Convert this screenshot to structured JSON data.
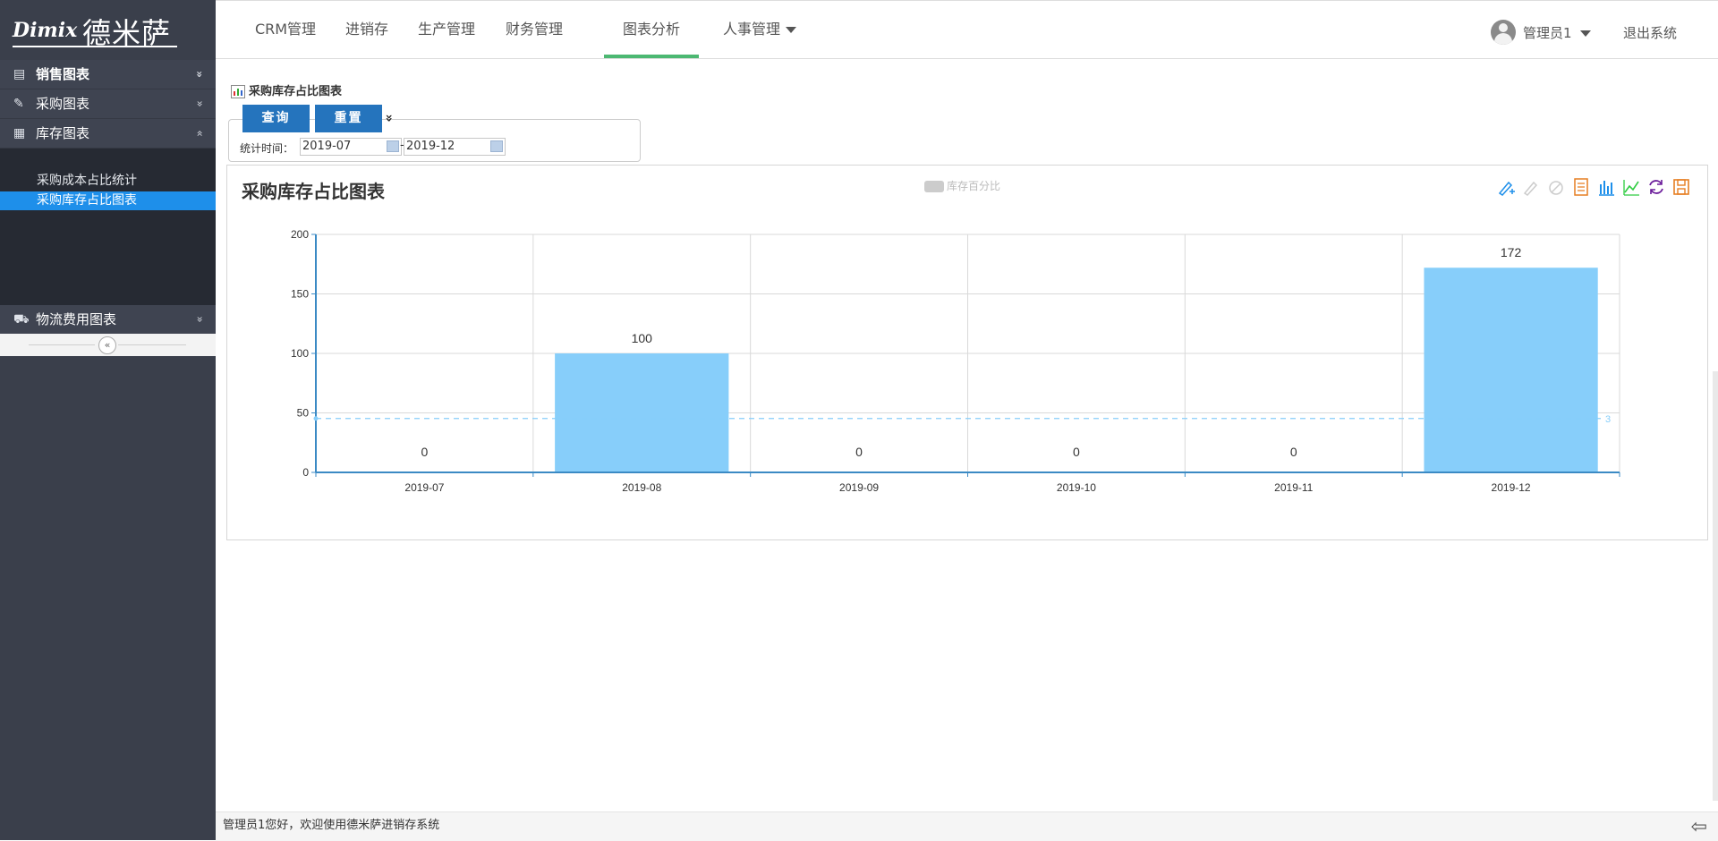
{
  "logo": {
    "latin": "Dimix",
    "cn": "德米萨"
  },
  "sidebar": {
    "groups": [
      {
        "label": "销售图表",
        "icon": "chart-card-icon",
        "chevron": "»"
      },
      {
        "label": "采购图表",
        "icon": "edit-icon",
        "chevron": "»"
      },
      {
        "label": "库存图表",
        "icon": "table-icon",
        "chevron": "«"
      }
    ],
    "sub_items": [
      {
        "label": "采购成本占比统计"
      },
      {
        "label": "采购库存占比图表"
      }
    ],
    "bottom_group": {
      "label": "物流费用图表",
      "icon": "truck-icon",
      "chevron": "»"
    },
    "collapse_glyph": "«"
  },
  "topnav": {
    "items": [
      "CRM管理",
      "进销存",
      "生产管理",
      "财务管理",
      "图表分析",
      "人事管理"
    ],
    "active_index": 4,
    "user_name": "管理员1",
    "logout": "退出系统"
  },
  "page": {
    "title": "采购库存占比图表",
    "query_button": "查询",
    "reset_button": "重置",
    "toggle_glyph": "»",
    "stat_label": "统计时间：",
    "date_from": "2019-07",
    "date_sep": "-",
    "date_to": "2019-12"
  },
  "chart_data": {
    "type": "bar",
    "title": "采购库存占比图表",
    "legend": [
      "库存百分比"
    ],
    "categories": [
      "2019-07",
      "2019-08",
      "2019-09",
      "2019-10",
      "2019-11",
      "2019-12"
    ],
    "series": [
      {
        "name": "库存百分比",
        "values": [
          0,
          100,
          0,
          0,
          0,
          172
        ],
        "color": "#87cefa"
      }
    ],
    "data_labels": [
      "0",
      "100",
      "0",
      "0",
      "0",
      "172"
    ],
    "yticks": [
      0,
      50,
      100,
      150,
      200
    ],
    "ylim": [
      0,
      200
    ],
    "average_line": {
      "value": 45.3,
      "label": "3",
      "color": "#87cefa"
    },
    "grid": true,
    "legend_position": "top-center",
    "toolbar_icons": [
      "mark-icon",
      "mark-undo-icon",
      "mark-clear-icon",
      "data-view-icon",
      "bar-type-icon",
      "line-type-icon",
      "restore-icon",
      "save-image-icon"
    ]
  },
  "footer": {
    "text": "管理员1您好，欢迎使用德米萨进销存系统",
    "icon": "exit-arrow-icon"
  },
  "colors": {
    "sidebar_bg": "#3a3f4b",
    "sidebar_active": "#1e8fea",
    "nav_active_underline": "#4cb872",
    "button_blue": "#2574bd",
    "bar_color": "#87cefa"
  }
}
